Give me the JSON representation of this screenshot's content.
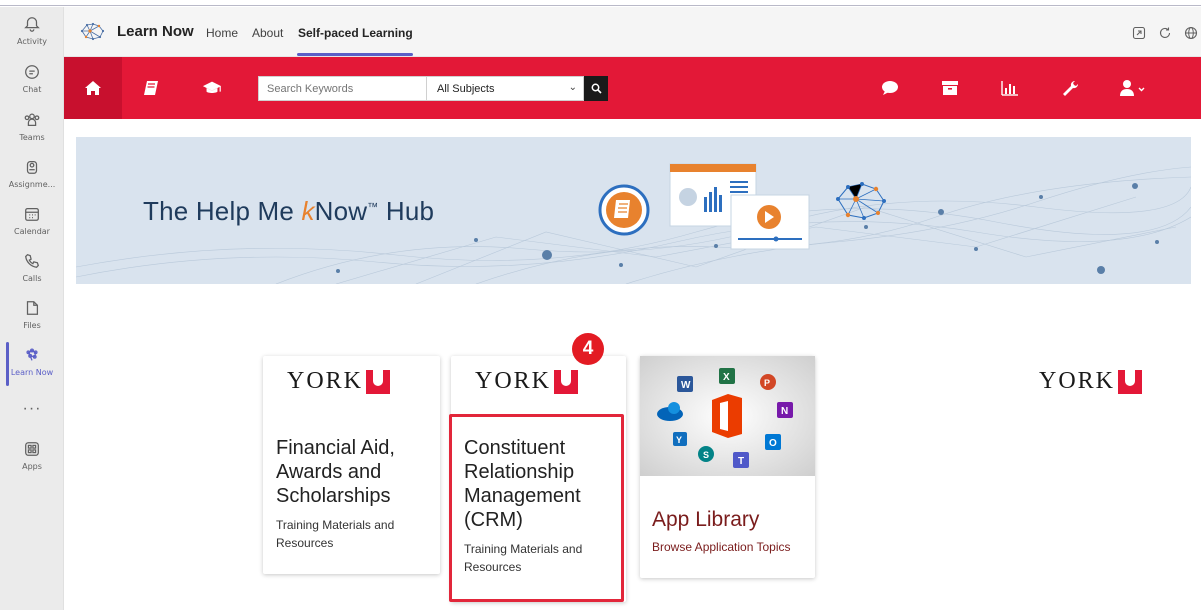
{
  "rail": {
    "items": [
      {
        "label": "Activity"
      },
      {
        "label": "Chat"
      },
      {
        "label": "Teams"
      },
      {
        "label": "Assignme..."
      },
      {
        "label": "Calendar"
      },
      {
        "label": "Calls"
      },
      {
        "label": "Files"
      },
      {
        "label": "Learn Now"
      },
      {
        "label": "Apps"
      }
    ],
    "more": "···"
  },
  "header": {
    "title": "Learn Now",
    "tabs": [
      {
        "label": "Home"
      },
      {
        "label": "About"
      },
      {
        "label": "Self-paced Learning"
      }
    ]
  },
  "navbar": {
    "search_placeholder": "Search Keywords",
    "subject_selected": "All Subjects"
  },
  "banner": {
    "title_part1": "The Help Me ",
    "title_k": "k",
    "title_part2": "Now",
    "title_tm": "™",
    "title_part3": " Hub"
  },
  "cards": [
    {
      "logo_text": "YORK",
      "title_lines": [
        "Financial Aid,",
        "Awards and",
        "Scholarships"
      ],
      "subtitle_lines": [
        "Training Materials and",
        "Resources"
      ]
    },
    {
      "logo_text": "YORK",
      "title_lines": [
        "Constituent",
        "Relationship",
        "Management",
        "(CRM)"
      ],
      "subtitle_lines": [
        "Training Materials and",
        "Resources"
      ]
    },
    {
      "title": "App Library",
      "subtitle": "Browse Application Topics"
    }
  ],
  "right_logo_text": "YORK",
  "step_badge": "4",
  "colors": {
    "york_red": "#e31837",
    "teams_purple": "#5b5fc7",
    "highlight": "#e2263a"
  }
}
